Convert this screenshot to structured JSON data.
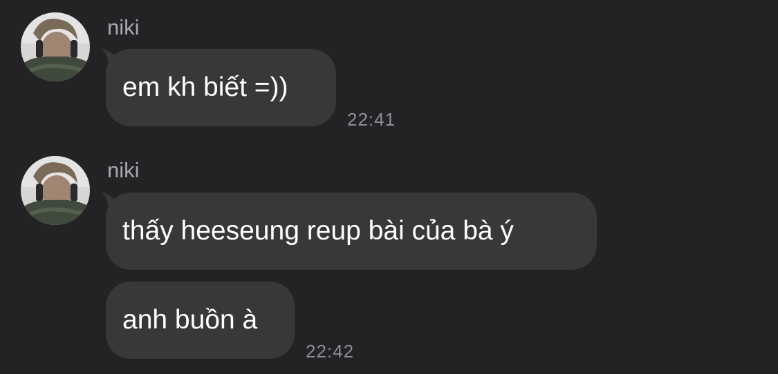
{
  "colors": {
    "background": "#232325",
    "bubble": "#38383b",
    "message_text": "#ffffff",
    "sender_text": "#a8a8ad",
    "time_text": "#8e8e93"
  },
  "messages": [
    {
      "sender": "niki",
      "avatar": "profile-photo-icon",
      "bubbles": [
        {
          "text": "em kh biết =))"
        }
      ],
      "time": "22:41"
    },
    {
      "sender": "niki",
      "avatar": "profile-photo-icon",
      "bubbles": [
        {
          "text": "thấy heeseung reup bài của bà ý"
        },
        {
          "text": "anh buồn à"
        }
      ],
      "time": "22:42"
    }
  ]
}
